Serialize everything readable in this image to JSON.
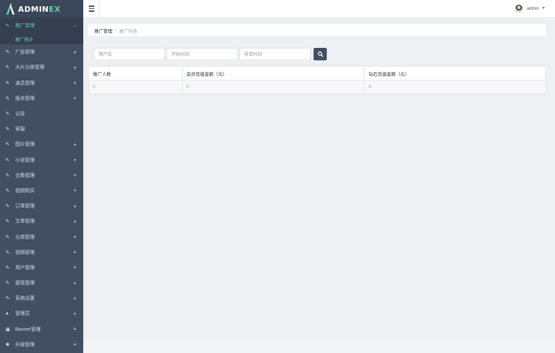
{
  "app": {
    "logo_main": "ADMIN",
    "logo_accent": "EX"
  },
  "sidebar": {
    "items": [
      {
        "label": "推广管理",
        "icon": "edit-icon",
        "toggle": "−",
        "active": true
      },
      {
        "label": "广告管理",
        "icon": "edit-icon",
        "toggle": "+"
      },
      {
        "label": "大片分类管理",
        "icon": "edit-icon",
        "toggle": "+"
      },
      {
        "label": "演员管理",
        "icon": "edit-icon",
        "toggle": "+"
      },
      {
        "label": "版本管理",
        "icon": "edit-icon",
        "toggle": "+"
      },
      {
        "label": "公告",
        "icon": "edit-icon",
        "toggle": ""
      },
      {
        "label": "客服",
        "icon": "edit-icon",
        "toggle": ""
      },
      {
        "label": "图片管理",
        "icon": "edit-icon",
        "toggle": "+"
      },
      {
        "label": "小说管理",
        "icon": "edit-icon",
        "toggle": "+"
      },
      {
        "label": "合集管理",
        "icon": "edit-icon",
        "toggle": "+"
      },
      {
        "label": "视频购买",
        "icon": "edit-icon",
        "toggle": "+"
      },
      {
        "label": "订单管理",
        "icon": "edit-icon",
        "toggle": "+"
      },
      {
        "label": "文章管理",
        "icon": "edit-icon",
        "toggle": "+"
      },
      {
        "label": "分类管理",
        "icon": "edit-icon",
        "toggle": "+"
      },
      {
        "label": "视频管理",
        "icon": "edit-icon",
        "toggle": "+"
      },
      {
        "label": "用户管理",
        "icon": "edit-icon",
        "toggle": "+"
      },
      {
        "label": "提现管理",
        "icon": "edit-icon",
        "toggle": "+"
      },
      {
        "label": "系统设置",
        "icon": "edit-icon",
        "toggle": "+"
      },
      {
        "label": "管理员",
        "icon": "user-icon",
        "toggle": "+"
      },
      {
        "label": "Banner管理",
        "icon": "image-icon",
        "toggle": "+"
      },
      {
        "label": "升级管理",
        "icon": "gear-icon",
        "toggle": "+"
      }
    ],
    "submenu": {
      "label": "推广统计"
    }
  },
  "header": {
    "username": "admin"
  },
  "breadcrumb": {
    "home": "推广管理",
    "current": "推广列表"
  },
  "search": {
    "username_placeholder": "用户名",
    "start_placeholder": "开始时间",
    "end_placeholder": "结束时间"
  },
  "table": {
    "columns": [
      "推广人数",
      "会员充值金额（元）",
      "钻石充值金额（元）"
    ],
    "rows": [
      [
        "0",
        "0",
        "0"
      ]
    ]
  },
  "colors": {
    "sidebar_bg": "#424f63",
    "accent": "#65cea7",
    "content_bg": "#eff0f4"
  }
}
